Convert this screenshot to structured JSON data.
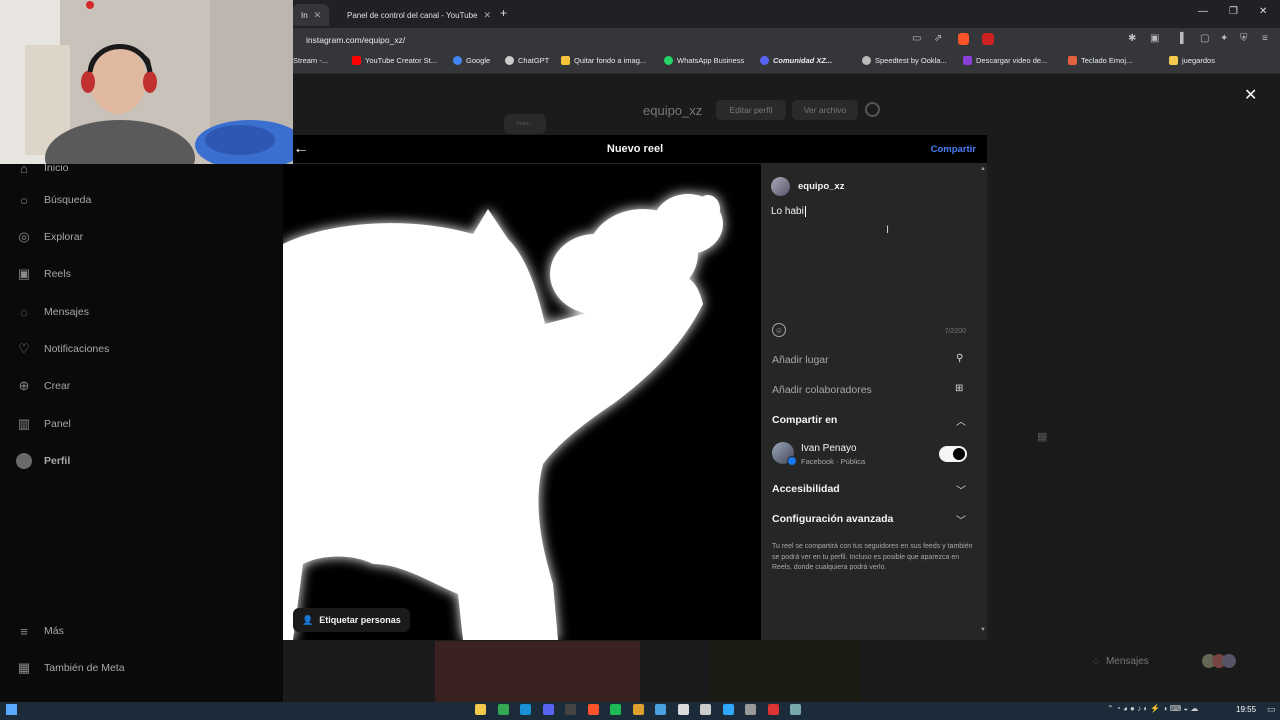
{
  "browser": {
    "tabs": [
      {
        "label": "In",
        "active": true
      },
      {
        "label": "Panel de control del canal - YouTube",
        "active": false
      }
    ],
    "new_tab_label": "+",
    "url": "instagram.com/equipo_xz/",
    "bookmarks": [
      {
        "label": "Stream -...",
        "color": "#6b6b6b"
      },
      {
        "label": "YouTube Creator St...",
        "color": "#ff0000"
      },
      {
        "label": "Google",
        "color": "#4285f4"
      },
      {
        "label": "ChatGPT",
        "color": "#cccccc"
      },
      {
        "label": "Quitar fondo a imag...",
        "color": "#f6c33a"
      },
      {
        "label": "WhatsApp Business",
        "color": "#25d366"
      },
      {
        "label": "Comunidad XZ...",
        "color": "#5865f2"
      },
      {
        "label": "Speedtest by Ookla...",
        "color": "#bbbbbb"
      },
      {
        "label": "Descargar video de...",
        "color": "#8b3fd9"
      },
      {
        "label": "Teclado Emoj...",
        "color": "#e06040"
      },
      {
        "label": "juegardos",
        "color": "#f2c94c"
      }
    ]
  },
  "profile_header": {
    "username": "equipo_xz",
    "edit_profile": "Editar perfil",
    "view_archive": "Ver archivo",
    "note": "Nota..."
  },
  "sidebar": {
    "items": [
      {
        "label": "Inicio",
        "icon": "home-icon"
      },
      {
        "label": "Búsqueda",
        "icon": "search-icon"
      },
      {
        "label": "Explorar",
        "icon": "compass-icon"
      },
      {
        "label": "Reels",
        "icon": "reels-icon"
      },
      {
        "label": "Mensajes",
        "icon": "messenger-icon"
      },
      {
        "label": "Notificaciones",
        "icon": "heart-icon"
      },
      {
        "label": "Crear",
        "icon": "plus-square-icon"
      },
      {
        "label": "Panel",
        "icon": "chart-icon"
      },
      {
        "label": "Perfil",
        "icon": "avatar-icon"
      }
    ],
    "more": "Más",
    "meta": "También de Meta"
  },
  "modal": {
    "title": "Nuevo reel",
    "share": "Compartir",
    "tag_people": "Etiquetar personas",
    "panel": {
      "username": "equipo_xz",
      "caption": "Lo habi",
      "char_count": "7/2200",
      "add_location": "Añadir lugar",
      "add_collaborators": "Añadir colaboradores",
      "share_to": "Compartir en",
      "account_name": "Ivan Penayo",
      "account_sub": "Facebook · Pública",
      "toggle_on": true,
      "accessibility": "Accesibilidad",
      "advanced": "Configuración avanzada",
      "notice": "Tu reel se compartirá con tus seguidores en sus feeds y también se podrá ver en tu perfil. Incluso es posible que aparezca en Reels, donde cualquiera podrá verlo."
    }
  },
  "messages_widget": {
    "label": "Mensajes"
  },
  "taskbar": {
    "time": "19:55",
    "icons": [
      {
        "name": "file-explorer-icon",
        "color": "#f2c94c"
      },
      {
        "name": "chrome-icon",
        "color": "#34a853"
      },
      {
        "name": "edge-icon",
        "color": "#1b8fd6"
      },
      {
        "name": "discord-icon",
        "color": "#5865f2"
      },
      {
        "name": "obs-icon",
        "color": "#444444"
      },
      {
        "name": "brave-icon",
        "color": "#fb542b"
      },
      {
        "name": "spotify-icon",
        "color": "#1db954"
      },
      {
        "name": "app-icon",
        "color": "#e0a030"
      },
      {
        "name": "app2-icon",
        "color": "#4aa3df"
      },
      {
        "name": "capcut-icon",
        "color": "#dddddd"
      },
      {
        "name": "vm-icon",
        "color": "#cccccc"
      },
      {
        "name": "photoshop-icon",
        "color": "#31a8ff"
      },
      {
        "name": "terminal-icon",
        "color": "#999999"
      },
      {
        "name": "davinci-icon",
        "color": "#d33"
      },
      {
        "name": "calculator-icon",
        "color": "#7aa"
      }
    ]
  }
}
